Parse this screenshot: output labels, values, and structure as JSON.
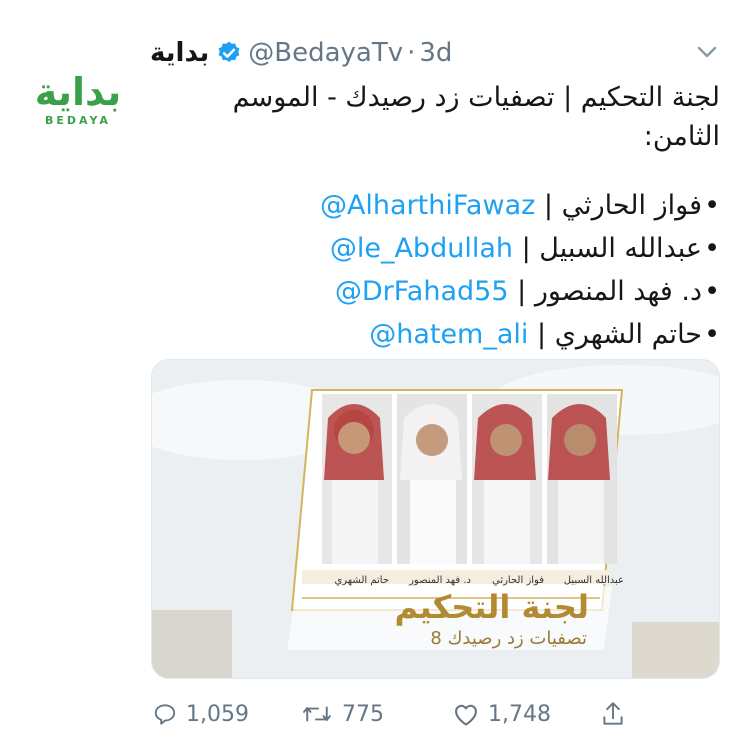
{
  "tweet": {
    "avatar": {
      "logo_ar": "بداية",
      "logo_en": "BEDAYA"
    },
    "display_name": "بداية",
    "handle": "@BedayaTv",
    "separator": "·",
    "time": "3d",
    "text_line1": "لجنة التحكيم | تصفيات زد رصيدك - الموسم",
    "text_line2": "الثامن:",
    "bullets": [
      {
        "name": "فواز الحارثي",
        "sep": "|",
        "mention": "@AlharthiFawaz"
      },
      {
        "name": "عبدالله السبيل",
        "sep": "|",
        "mention": "@le_Abdullah"
      },
      {
        "name": "د. فهد المنصور",
        "sep": "|",
        "mention": "@DrFahad55"
      },
      {
        "name": "حاتم الشهري",
        "sep": "|",
        "mention": "@hatem_ali"
      }
    ],
    "media": {
      "title": "لجنة التحكيم",
      "subtitle": "تصفيات زد رصيدك 8",
      "names": [
        "عبدالله السبيل",
        "فواز الحارثي",
        "د. فهد المنصور",
        "حاتم الشهري"
      ]
    },
    "actions": {
      "replies": "1,059",
      "retweets": "775",
      "likes": "1,748"
    }
  },
  "colors": {
    "accent": "#1da1f2",
    "muted": "#657786",
    "brand_green": "#3aa14a",
    "gold": "#b28a32"
  },
  "icons": [
    "verified-badge-icon",
    "chevron-down-icon",
    "reply-icon",
    "retweet-icon",
    "like-icon",
    "share-icon"
  ]
}
